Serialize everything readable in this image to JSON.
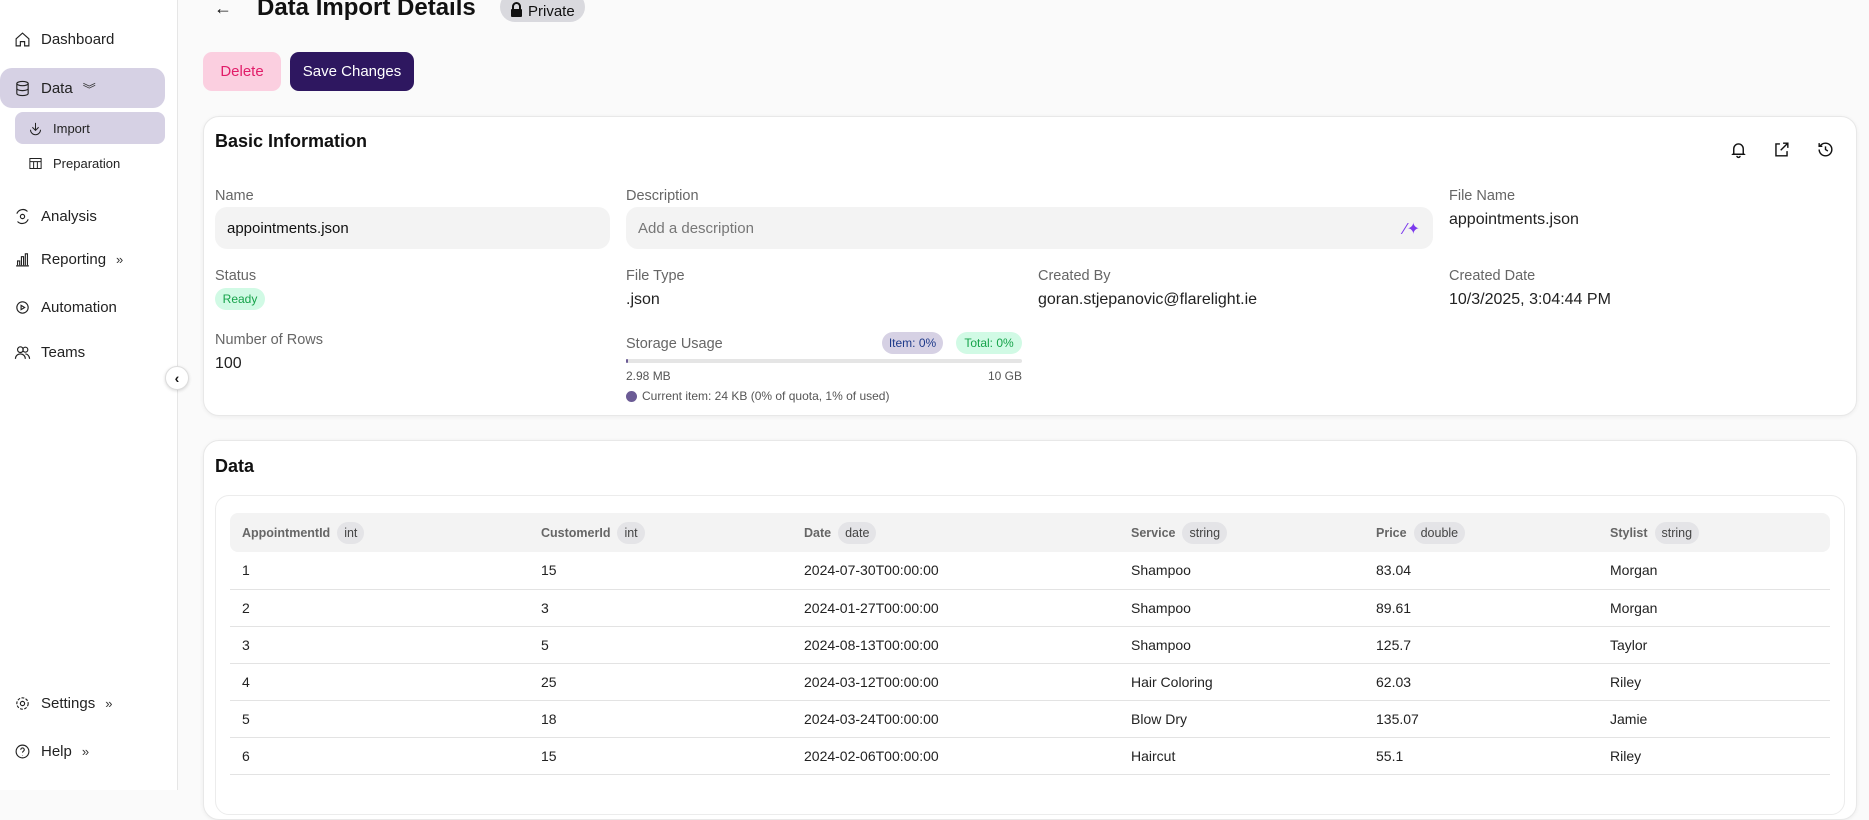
{
  "sidebar": {
    "items": [
      {
        "label": "Dashboard",
        "icon": "home-icon"
      },
      {
        "label": "Data",
        "icon": "database-icon"
      },
      {
        "label": "Import",
        "icon": "download-icon"
      },
      {
        "label": "Preparation",
        "icon": "table-icon"
      },
      {
        "label": "Analysis",
        "icon": "analysis-icon"
      },
      {
        "label": "Reporting",
        "icon": "bar-chart-icon"
      },
      {
        "label": "Automation",
        "icon": "automation-icon"
      },
      {
        "label": "Teams",
        "icon": "users-icon"
      },
      {
        "label": "Settings",
        "icon": "gear-icon"
      },
      {
        "label": "Help",
        "icon": "help-icon"
      }
    ]
  },
  "header": {
    "title": "Data Import Details",
    "visibility": "Private"
  },
  "actions": {
    "delete": "Delete",
    "save": "Save Changes"
  },
  "basic": {
    "title": "Basic Information",
    "name_label": "Name",
    "name_value": "appointments.json",
    "description_label": "Description",
    "description_placeholder": "Add a description",
    "file_name_label": "File Name",
    "file_name": "appointments.json",
    "status_label": "Status",
    "status": "Ready",
    "file_type_label": "File Type",
    "file_type": ".json",
    "created_by_label": "Created By",
    "created_by": "goran.stjepanovic@flarelight.ie",
    "created_date_label": "Created Date",
    "created_date": "10/3/2025, 3:04:44 PM",
    "rows_label": "Number of Rows",
    "rows": "100",
    "storage": {
      "label": "Storage Usage",
      "item_badge": "Item: 0%",
      "total_badge": "Total: 0%",
      "used": "2.98 MB",
      "quota": "10 GB",
      "used_fraction": 0.0003,
      "current_item": "Current item: 24 KB (0% of quota, 1% of used)"
    }
  },
  "data": {
    "title": "Data",
    "columns": [
      {
        "name": "AppointmentId",
        "type": "int"
      },
      {
        "name": "CustomerId",
        "type": "int"
      },
      {
        "name": "Date",
        "type": "date"
      },
      {
        "name": "Service",
        "type": "string"
      },
      {
        "name": "Price",
        "type": "double"
      },
      {
        "name": "Stylist",
        "type": "string"
      }
    ],
    "rows": [
      [
        "1",
        "15",
        "2024-07-30T00:00:00",
        "Shampoo",
        "83.04",
        "Morgan"
      ],
      [
        "2",
        "3",
        "2024-01-27T00:00:00",
        "Shampoo",
        "89.61",
        "Morgan"
      ],
      [
        "3",
        "5",
        "2024-08-13T00:00:00",
        "Shampoo",
        "125.7",
        "Taylor"
      ],
      [
        "4",
        "25",
        "2024-03-12T00:00:00",
        "Hair Coloring",
        "62.03",
        "Riley"
      ],
      [
        "5",
        "18",
        "2024-03-24T00:00:00",
        "Blow Dry",
        "135.07",
        "Jamie"
      ],
      [
        "6",
        "15",
        "2024-02-06T00:00:00",
        "Haircut",
        "55.1",
        "Riley"
      ]
    ]
  },
  "colors": {
    "accent": "#2e1760",
    "pill": "#d6d1e4",
    "ready": "#16a34a",
    "delete_bg": "#fbcfe0",
    "delete_fg": "#e11d69"
  }
}
